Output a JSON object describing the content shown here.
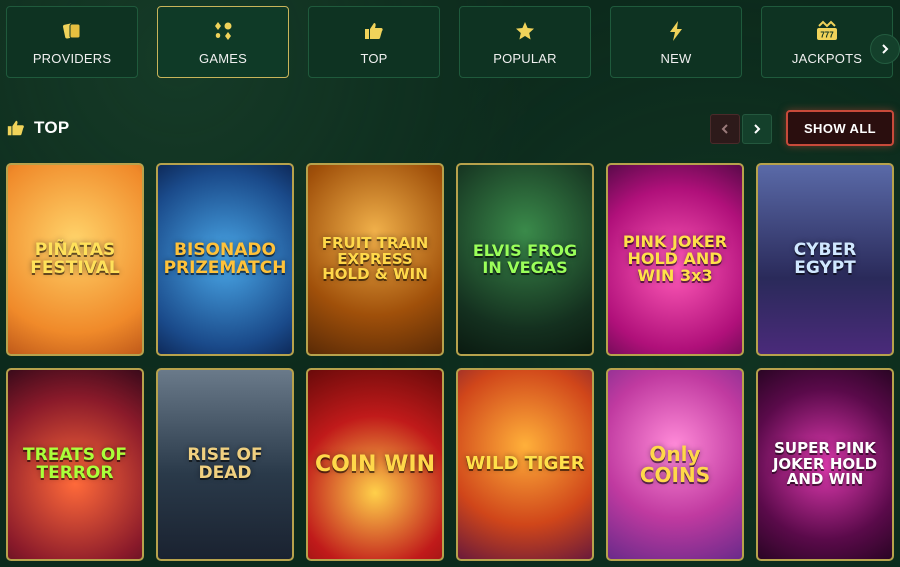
{
  "categories": [
    {
      "label": "PROVIDERS",
      "icon": "cards-icon",
      "active": false
    },
    {
      "label": "GAMES",
      "icon": "suits-icon",
      "active": true
    },
    {
      "label": "TOP",
      "icon": "thumbs-up-icon",
      "active": false
    },
    {
      "label": "POPULAR",
      "icon": "star-icon",
      "active": false
    },
    {
      "label": "NEW",
      "icon": "lightning-icon",
      "active": false
    },
    {
      "label": "JACKPOTS",
      "icon": "slot-777-icon",
      "active": false
    }
  ],
  "section": {
    "title": "TOP",
    "show_all": "SHOW ALL"
  },
  "games": [
    {
      "title": "PIÑATAS FESTIVAL",
      "bg": "#f2a43a"
    },
    {
      "title": "BISONADO PRIZEMATCH",
      "bg": "#2a6fa8"
    },
    {
      "title": "FRUIT TRAIN EXPRESS HOLD & WIN",
      "bg": "#8a3a0a"
    },
    {
      "title": "ELVIS FROG IN VEGAS",
      "bg": "#1a3a2a"
    },
    {
      "title": "PINK JOKER HOLD AND WIN 3x3",
      "bg": "#b01a8a"
    },
    {
      "title": "CYBER EGYPT",
      "bg": "#3a3a7a"
    },
    {
      "title": "TREATS OF TERROR",
      "bg": "#8a1a2a"
    },
    {
      "title": "RISE OF DEAD",
      "bg": "#3a4a5a"
    },
    {
      "title": "COIN WIN",
      "bg": "#a80f1a"
    },
    {
      "title": "WILD TIGER",
      "bg": "#d0461a"
    },
    {
      "title": "Only COINS",
      "bg": "#c03aa0"
    },
    {
      "title": "SUPER PINK JOKER HOLD AND WIN",
      "bg": "#5a0a4a"
    }
  ],
  "colors": {
    "accent_gold": "#c8b45a",
    "show_all_border": "#c84a3a",
    "background": "#0c2a1c"
  }
}
